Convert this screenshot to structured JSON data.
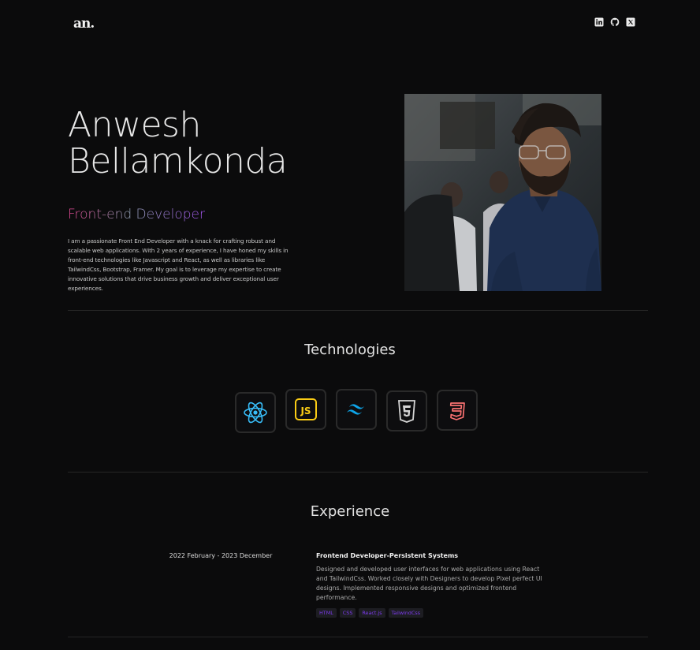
{
  "nav": {
    "logo": "an.",
    "socials": [
      {
        "name": "linkedin-icon"
      },
      {
        "name": "github-icon"
      },
      {
        "name": "x-twitter-icon"
      }
    ]
  },
  "hero": {
    "first_name": "Anwesh",
    "last_name": "Bellamkonda",
    "role": "Front-end Developer",
    "bio": "I am a passionate Front End Developer with a knack for crafting robust and scalable web applications. With 2 years of experience, I have honed my skills in front-end technologies like Javascript and React, as well as libraries like TailwindCss, Bootstrap, Framer. My goal is to leverage my expertise to create innovative solutions that drive business growth and deliver exceptional user experiences."
  },
  "technologies": {
    "title": "Technologies",
    "items": [
      {
        "icon": "react-icon",
        "color": "#38bdf8"
      },
      {
        "icon": "javascript-icon",
        "color": "#facc15"
      },
      {
        "icon": "tailwindcss-icon",
        "color": "#0ea5e9"
      },
      {
        "icon": "html5-icon",
        "color": "#d4d4d4"
      },
      {
        "icon": "css3-icon",
        "color": "#f87171"
      }
    ]
  },
  "experience": {
    "title": "Experience",
    "items": [
      {
        "date": "2022 February - 2023 December",
        "title": "Frontend Developer-Persistent Systems",
        "description": "Designed and developed user interfaces for web applications using React and TailwindCss. Worked closely with Designers to develop Pixel perfect UI designs. Implemented responsive designs and optimized frontend performance.",
        "tags": [
          "HTML",
          "CSS",
          "React.js",
          "TailwindCss"
        ]
      }
    ]
  },
  "colors": {
    "background": "#0b0b0c",
    "accent_purple": "#a855f7",
    "accent_pink": "#ec4899",
    "tag_text": "#7c3aed"
  }
}
